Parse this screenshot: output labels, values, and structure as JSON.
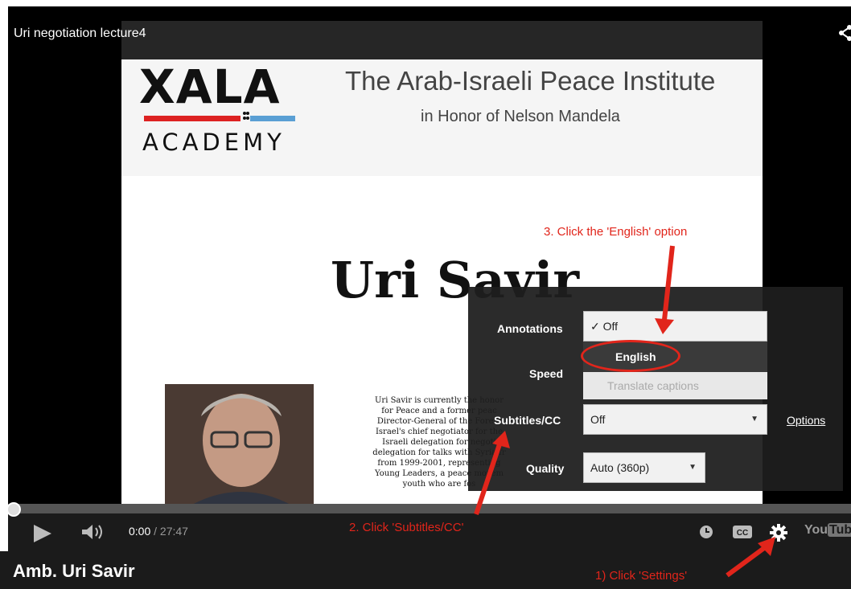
{
  "player": {
    "title": "Uri negotiation lecture4",
    "time_current": "0:00",
    "time_total": " / 27:47",
    "progress_fraction": 0.0,
    "youtube_logo_a": "You",
    "youtube_logo_b": "Tube"
  },
  "slide": {
    "logo_word": "ꓫALA",
    "logo_sub": "ACADEMY",
    "institute_title": "The Arab-Israeli Peace Institute",
    "institute_subtitle": "in Honor of Nelson Mandela",
    "speaker_name": "Uri Savir",
    "bio_lines": [
      "Uri Savir is currently the honor",
      "for Peace and a former peac",
      "Director-General of the Foreig",
      "Israel's chief negotiator for the",
      "Israeli delegation for negoti",
      "delegation for talks with Syria fr",
      "from 1999-2001, representing",
      "Young Leaders, a peace movem",
      "youth who are fos"
    ]
  },
  "settings": {
    "annotations_label": "Annotations",
    "annotations_value": "✓ Off",
    "english_option": "English",
    "speed_label": "Speed",
    "translate_option": "Translate captions",
    "subtitles_label": "Subtitles/CC",
    "subtitles_value": "Off",
    "options_link": "Options",
    "quality_label": "Quality",
    "quality_value": "Auto (360p)"
  },
  "instructions": {
    "step1": "1) Click 'Settings'",
    "step2": "2. Click 'Subtitles/CC'",
    "step3": "3. Click the 'English' option"
  },
  "caption": {
    "title": "Amb. Uri Savir"
  },
  "colors": {
    "annotation_red": "#e1251b",
    "player_bg": "#000000",
    "control_bar": "#1b1b1b"
  },
  "icons": [
    "share-icon",
    "play-icon",
    "volume-icon",
    "clock-icon",
    "cc-icon",
    "gear-icon",
    "dropdown-caret-icon"
  ]
}
